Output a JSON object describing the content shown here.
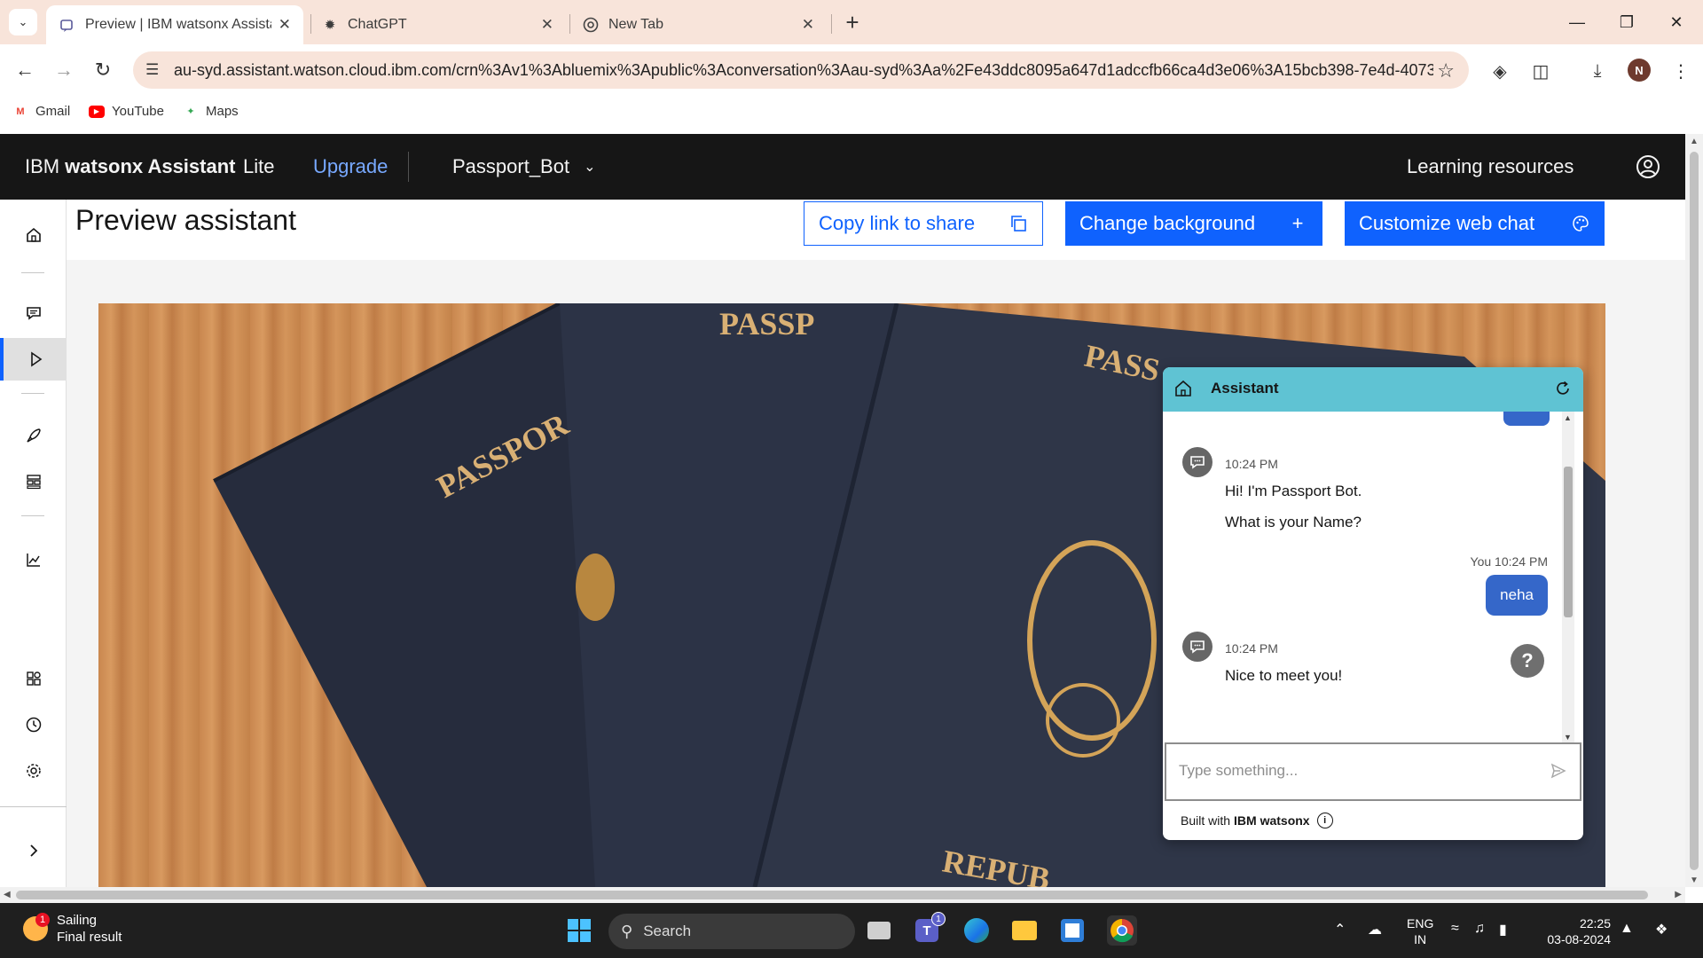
{
  "browser": {
    "tabs": [
      {
        "title": "Preview | IBM watsonx Assistant",
        "active": true,
        "icon": "watsonx-favicon"
      },
      {
        "title": "ChatGPT",
        "active": false,
        "icon": "chatgpt-favicon"
      },
      {
        "title": "New Tab",
        "active": false,
        "icon": "chrome-favicon"
      }
    ],
    "url": "au-syd.assistant.watson.cloud.ibm.com/crn%3Av1%3Abluemix%3Apublic%3Aconversation%3Aau-syd%3Aa%2Fe43ddc8095a647d1adccfb66ca4d3e06%3A15bcb398-7e4d-4073-9bd...",
    "profile_initial": "N",
    "bookmarks": [
      {
        "label": "Gmail",
        "icon": "gmail-icon"
      },
      {
        "label": "YouTube",
        "icon": "youtube-icon"
      },
      {
        "label": "Maps",
        "icon": "maps-icon"
      }
    ]
  },
  "header": {
    "brand_prefix": "IBM",
    "brand_name": "watsonx Assistant",
    "plan": "Lite",
    "upgrade": "Upgrade",
    "assistant_name": "Passport_Bot",
    "learning_resources": "Learning resources"
  },
  "page": {
    "title": "Preview assistant",
    "copy_link": "Copy link to share",
    "change_background": "Change background",
    "customize": "Customize web chat"
  },
  "chat": {
    "header_title": "Assistant",
    "messages": [
      {
        "time": "10:24 PM",
        "line1": "Hi! I'm Passport Bot.",
        "line2": "What is your Name?"
      },
      {
        "meta": "You 10:24 PM",
        "text": "neha"
      },
      {
        "time": "10:24 PM",
        "line1": "Nice to meet you!"
      }
    ],
    "input_placeholder": "Type something...",
    "footer_prefix": "Built with",
    "footer_brand": "IBM watsonx",
    "help_label": "?"
  },
  "taskbar": {
    "weather_title": "Sailing",
    "weather_sub": "Final result",
    "weather_badge": "1",
    "search_label": "Search",
    "teams_badge": "1",
    "lang_line1": "ENG",
    "lang_line2": "IN",
    "time": "22:25",
    "date": "03-08-2024"
  },
  "colors": {
    "ibm_blue": "#0f62fe",
    "header_bg": "#161616",
    "chat_header": "#5fc3d3",
    "user_bubble": "#3567c9",
    "tabstrip": "#f8e4da"
  }
}
